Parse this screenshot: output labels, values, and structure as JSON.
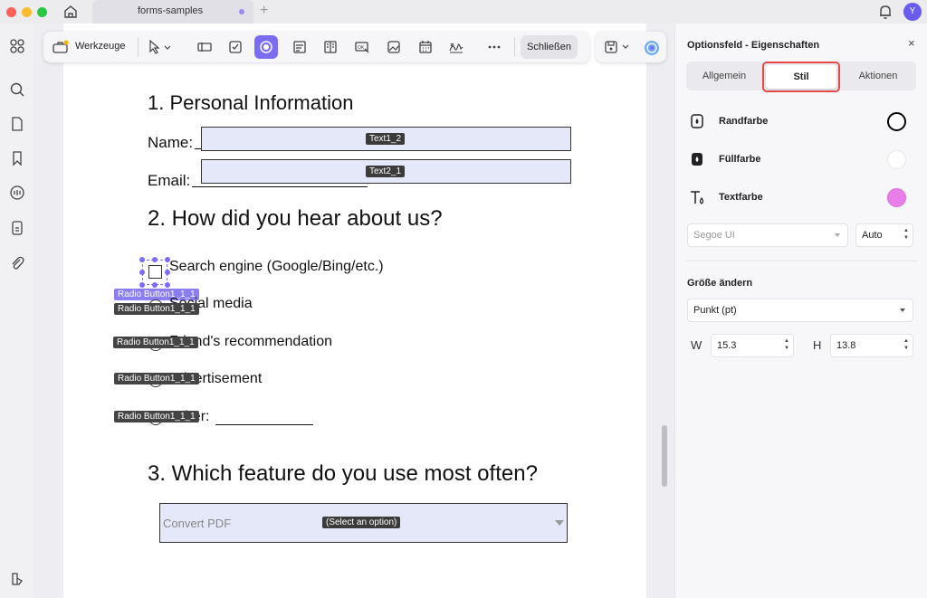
{
  "window": {
    "tab_title": "forms-samples",
    "avatar_initial": "Y"
  },
  "toolbar": {
    "tools_label": "Werkzeuge",
    "close_label": "Schließen"
  },
  "document": {
    "section1_title": "1. Personal Information",
    "name_label": "Name:",
    "name_field_tag": "Text1_2",
    "email_label": "Email:",
    "email_field_tag": "Text2_1",
    "section2_title": "2. How did you hear about us?",
    "options": [
      {
        "text": "Search engine (Google/Bing/etc.)",
        "tag": "Radio Button1_1_1"
      },
      {
        "text": "Social media",
        "tag": "Radio Button1_1_1"
      },
      {
        "text": "Friend's recommendation",
        "tag": "Radio Button1_1_1"
      },
      {
        "text": "Advertisement",
        "tag": "Radio Button1_1_1"
      },
      {
        "text": "Other:",
        "tag": "Radio Button1_1_1"
      }
    ],
    "section3_title": "3. Which feature do you use most often?",
    "dropdown_value": "Convert PDF",
    "dropdown_tag": "(Select an option)"
  },
  "panel": {
    "title": "Optionsfeld - Eigenschaften",
    "tabs": [
      "Allgemein",
      "Stil",
      "Aktionen"
    ],
    "active_tab": "Stil",
    "border_color_label": "Randfarbe",
    "fill_color_label": "Füllfarbe",
    "text_color_label": "Textfarbe",
    "border_color": "#000000",
    "fill_color": "#ffffff",
    "text_color": "#e87ee8",
    "font_name": "Segoe UI",
    "font_size": "Auto",
    "resize_label": "Größe ändern",
    "unit": "Punkt (pt)",
    "width_label": "W",
    "width_value": "15.3",
    "height_label": "H",
    "height_value": "13.8"
  },
  "colors": {
    "accent": "#7b6cf6",
    "highlight_border": "#e24a4a",
    "field_fill": "#e4e8f8"
  }
}
